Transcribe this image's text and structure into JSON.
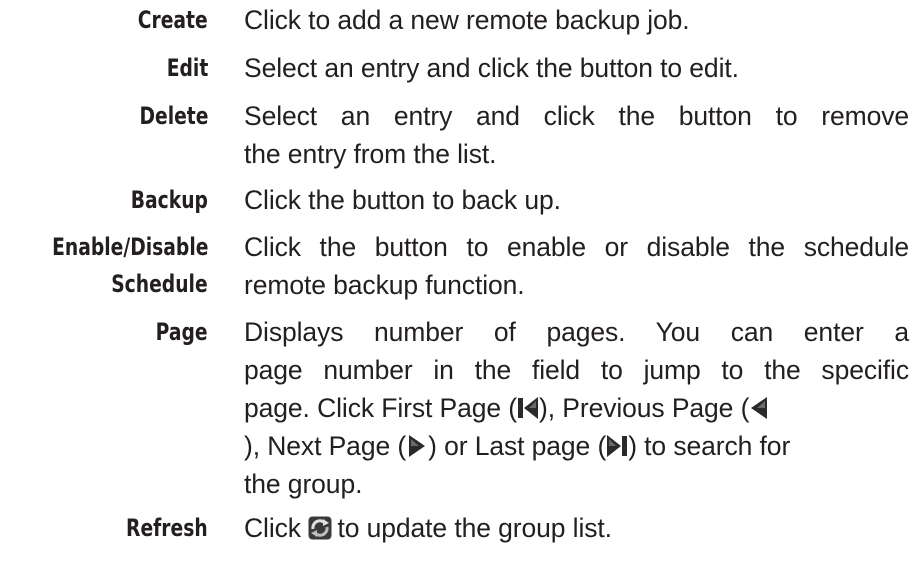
{
  "entries": [
    {
      "term": "Create",
      "desc": [
        "Click to add a new remote backup job."
      ]
    },
    {
      "term": "Edit",
      "desc": [
        "Select an entry and click the button to edit."
      ]
    },
    {
      "term": "Delete",
      "desc": [
        "Select an entry and click the button to remove",
        "the entry from the list."
      ]
    },
    {
      "term": "Backup",
      "desc": [
        "Click the button to back up."
      ]
    },
    {
      "term": [
        "Enable/Disable",
        "Schedule"
      ],
      "desc": [
        "Click the button to enable or disable the schedule",
        "remote backup function."
      ]
    },
    {
      "term": "Page",
      "desc": [
        "Displays number of pages. You can enter a",
        "page number in the field to jump to the specific"
      ],
      "line3_a": "page. Click First Page (",
      "line3_b": "), Previous Page (",
      "line4_a": "), Next Page (",
      "line4_b": ") or Last page (",
      "line4_c": ") to search for",
      "line5": "the group."
    },
    {
      "term": "Refresh",
      "desc_a": "Click ",
      "desc_b": " to update the group list."
    }
  ],
  "icons": {
    "first_page": "first-page-icon",
    "previous_page": "previous-page-icon",
    "next_page": "next-page-icon",
    "last_page": "last-page-icon",
    "refresh": "refresh-icon"
  }
}
